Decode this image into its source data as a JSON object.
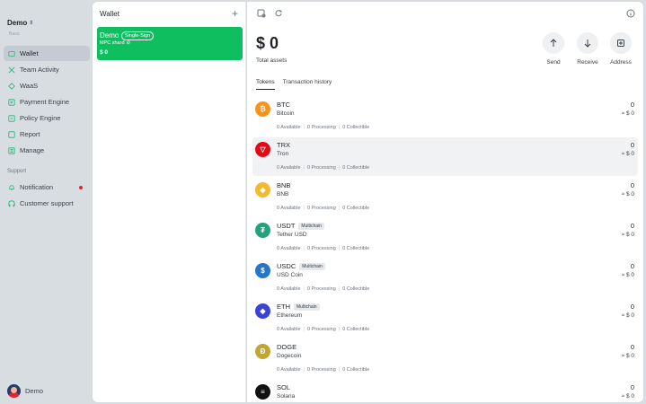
{
  "sidebar": {
    "org_name": "Demo",
    "org_sub": "Basic",
    "items": [
      {
        "label": "Wallet",
        "icon": "wallet-icon"
      },
      {
        "label": "Team Activity",
        "icon": "activity-icon"
      },
      {
        "label": "WaaS",
        "icon": "waas-icon"
      },
      {
        "label": "Payment Engine",
        "icon": "payment-icon"
      },
      {
        "label": "Policy Engine",
        "icon": "policy-icon"
      },
      {
        "label": "Report",
        "icon": "report-icon"
      },
      {
        "label": "Manage",
        "icon": "manage-icon"
      }
    ],
    "support_label": "Support",
    "support_items": [
      {
        "label": "Notification",
        "icon": "bell-icon"
      },
      {
        "label": "Customer support",
        "icon": "headset-icon"
      }
    ],
    "user_name": "Demo"
  },
  "wallet_panel": {
    "title": "Wallet",
    "add_label": "+",
    "card": {
      "name": "Demo",
      "badge": "Single-Sign",
      "mpc_label": "MPC shard",
      "amount": "$ 0"
    }
  },
  "main": {
    "balance": "$ 0",
    "balance_label": "Total assets",
    "actions": [
      {
        "label": "Send",
        "icon": "arrow-up-icon"
      },
      {
        "label": "Receive",
        "icon": "arrow-down-icon"
      },
      {
        "label": "Address",
        "icon": "address-icon"
      }
    ],
    "tabs": [
      "Tokens",
      "Transaction history"
    ],
    "tokens": [
      {
        "symbol": "BTC",
        "name": "Bitcoin",
        "tag": "",
        "balance": "0",
        "fiat": "≈ $ 0",
        "available": "0 Available",
        "processing": "0 Processing",
        "collectible": "0 Collectible",
        "color": "#f7931a",
        "glyph": "₿"
      },
      {
        "symbol": "TRX",
        "name": "Tron",
        "tag": "",
        "balance": "0",
        "fiat": "≈ $ 0",
        "available": "0 Available",
        "processing": "0 Processing",
        "collectible": "0 Collectible",
        "color": "#e50914",
        "glyph": "▽"
      },
      {
        "symbol": "BNB",
        "name": "BNB",
        "tag": "",
        "balance": "0",
        "fiat": "≈ $ 0",
        "available": "0 Available",
        "processing": "0 Processing",
        "collectible": "0 Collectible",
        "color": "#f3ba2f",
        "glyph": "◈"
      },
      {
        "symbol": "USDT",
        "name": "Tether USD",
        "tag": "Multichain",
        "balance": "0",
        "fiat": "≈ $ 0",
        "available": "0 Available",
        "processing": "0 Processing",
        "collectible": "0 Collectible",
        "color": "#26a17b",
        "glyph": "₮"
      },
      {
        "symbol": "USDC",
        "name": "USD Coin",
        "tag": "Multichain",
        "balance": "0",
        "fiat": "≈ $ 0",
        "available": "0 Available",
        "processing": "0 Processing",
        "collectible": "0 Collectible",
        "color": "#2775ca",
        "glyph": "$"
      },
      {
        "symbol": "ETH",
        "name": "Ethereum",
        "tag": "Multichain",
        "balance": "0",
        "fiat": "≈ $ 0",
        "available": "0 Available",
        "processing": "0 Processing",
        "collectible": "0 Collectible",
        "color": "#3b43d6",
        "glyph": "◆"
      },
      {
        "symbol": "DOGE",
        "name": "Dogecoin",
        "tag": "",
        "balance": "0",
        "fiat": "≈ $ 0",
        "available": "0 Available",
        "processing": "0 Processing",
        "collectible": "0 Collectible",
        "color": "#c2a633",
        "glyph": "Ð"
      },
      {
        "symbol": "SOL",
        "name": "Solana",
        "tag": "",
        "balance": "0",
        "fiat": "≈ $ 0",
        "available": "",
        "processing": "",
        "collectible": "",
        "color": "#111111",
        "glyph": "≡"
      }
    ]
  },
  "colors": {
    "accent": "#0fbf5f",
    "sidebar_bg": "#d8dde2",
    "active_bg": "#c4cbd2",
    "notification_dot": "#e2242e"
  }
}
